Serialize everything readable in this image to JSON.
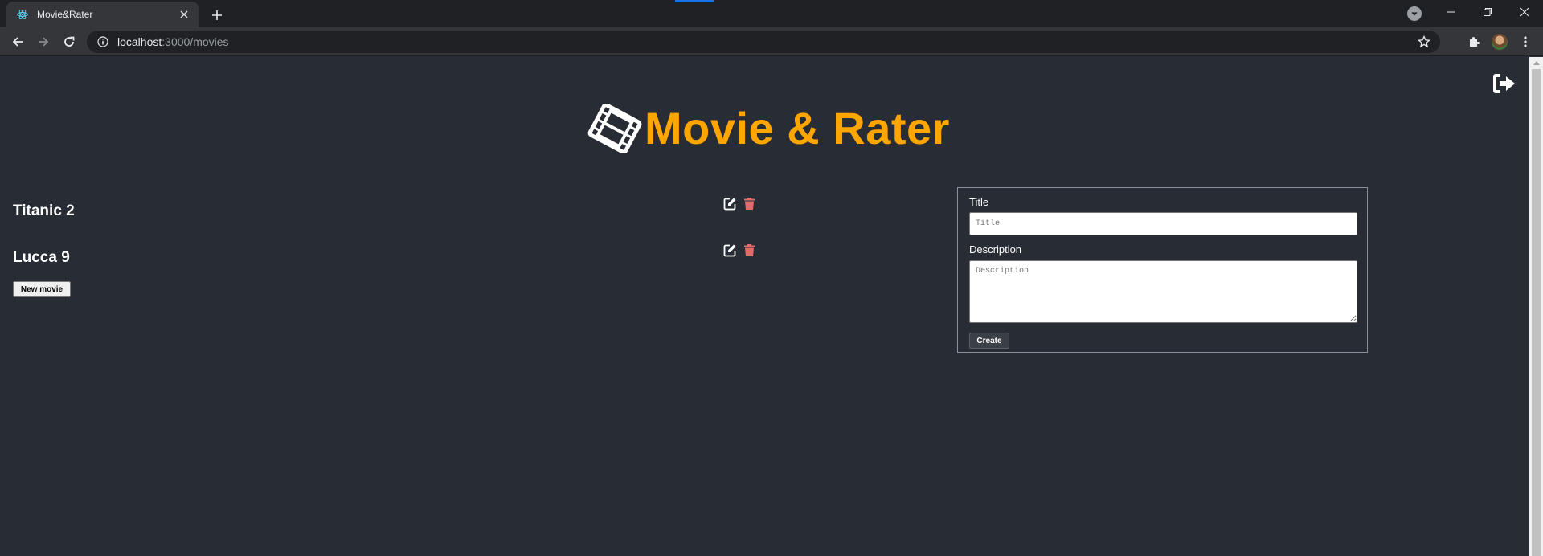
{
  "browser": {
    "tab_title": "Movie&Rater",
    "url_host": "localhost",
    "url_path": ":3000/movies"
  },
  "header": {
    "title": "Movie & Rater",
    "title_color": "#ffa500",
    "icon": "film-icon"
  },
  "movies": [
    {
      "title": "Titanic 2"
    },
    {
      "title": "Lucca 9"
    }
  ],
  "actions": {
    "new_movie_label": "New movie",
    "edit_icon": "edit-icon",
    "delete_icon": "trash-icon",
    "delete_color": "#e06c6c",
    "logout_icon": "sign-out-icon"
  },
  "form": {
    "title_label": "Title",
    "title_placeholder": "Title",
    "description_label": "Description",
    "description_placeholder": "Description",
    "create_label": "Create"
  },
  "colors": {
    "background": "#282c34",
    "text": "#ffffff"
  }
}
